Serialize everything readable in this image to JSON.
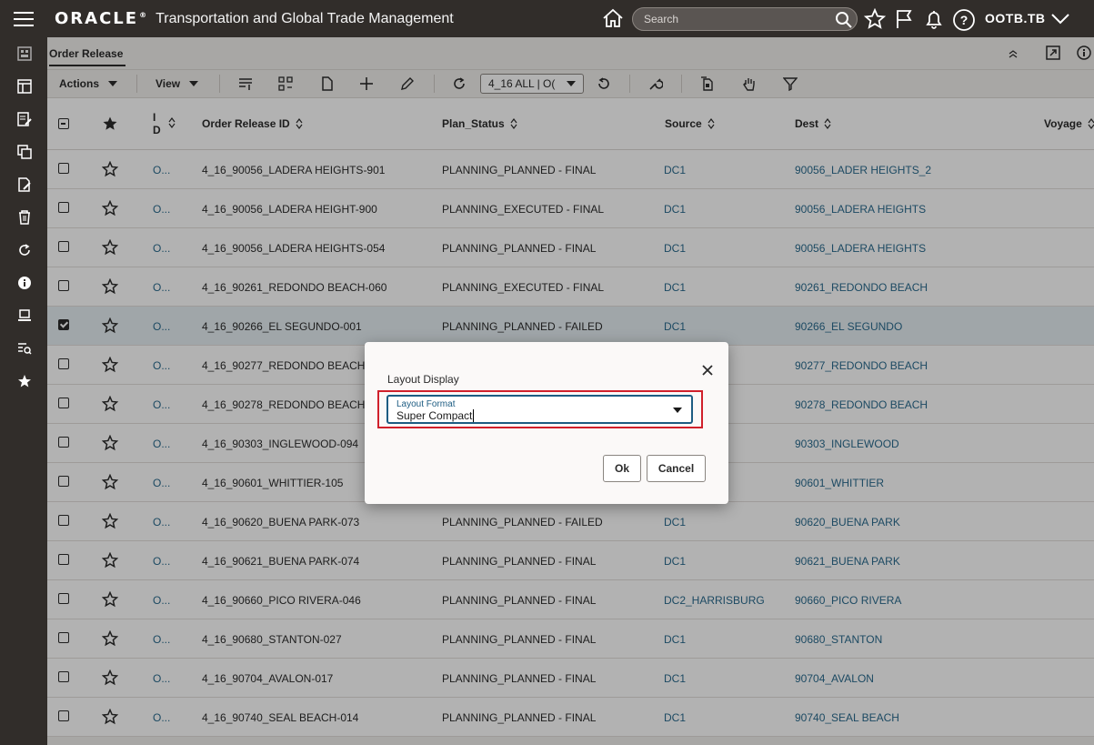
{
  "app": {
    "brand": "ORACLE",
    "title": "Transportation and Global Trade Management",
    "user": "OOTB.TB"
  },
  "search": {
    "placeholder": "Search"
  },
  "panel": {
    "title": "Order Release"
  },
  "toolbar": {
    "actions_label": "Actions",
    "view_label": "View",
    "saved_query": "4_16 ALL | O("
  },
  "table": {
    "headers": {
      "id": "I D",
      "order_release_id": "Order Release ID",
      "plan_status": "Plan_Status",
      "source": "Source",
      "dest": "Dest",
      "voyage": "Voyage"
    },
    "rows": [
      {
        "id": "O...",
        "order_release_id": "4_16_90056_LADERA HEIGHTS-901",
        "plan_status": "PLANNING_PLANNED - FINAL",
        "source": "DC1",
        "dest": "90056_LADER HEIGHTS_2",
        "checked": false
      },
      {
        "id": "O...",
        "order_release_id": "4_16_90056_LADERA HEIGHT-900",
        "plan_status": "PLANNING_EXECUTED - FINAL",
        "source": "DC1",
        "dest": "90056_LADERA HEIGHTS",
        "checked": false
      },
      {
        "id": "O...",
        "order_release_id": "4_16_90056_LADERA HEIGHTS-054",
        "plan_status": "PLANNING_PLANNED - FINAL",
        "source": "DC1",
        "dest": "90056_LADERA HEIGHTS",
        "checked": false
      },
      {
        "id": "O...",
        "order_release_id": "4_16_90261_REDONDO BEACH-060",
        "plan_status": "PLANNING_EXECUTED - FINAL",
        "source": "DC1",
        "dest": "90261_REDONDO BEACH",
        "checked": false
      },
      {
        "id": "O...",
        "order_release_id": "4_16_90266_EL SEGUNDO-001",
        "plan_status": "PLANNING_PLANNED - FAILED",
        "source": "DC1",
        "dest": "90266_EL SEGUNDO",
        "checked": true
      },
      {
        "id": "O...",
        "order_release_id": "4_16_90277_REDONDO BEACH",
        "plan_status": "",
        "source": "",
        "dest": "90277_REDONDO BEACH",
        "checked": false
      },
      {
        "id": "O...",
        "order_release_id": "4_16_90278_REDONDO BEACH",
        "plan_status": "",
        "source": "",
        "dest": "90278_REDONDO BEACH",
        "checked": false
      },
      {
        "id": "O...",
        "order_release_id": "4_16_90303_INGLEWOOD-094",
        "plan_status": "",
        "source": "",
        "dest": "90303_INGLEWOOD",
        "checked": false
      },
      {
        "id": "O...",
        "order_release_id": "4_16_90601_WHITTIER-105",
        "plan_status": "",
        "source": "",
        "dest": "90601_WHITTIER",
        "checked": false
      },
      {
        "id": "O...",
        "order_release_id": "4_16_90620_BUENA PARK-073",
        "plan_status": "PLANNING_PLANNED - FAILED",
        "source": "DC1",
        "dest": "90620_BUENA PARK",
        "checked": false
      },
      {
        "id": "O...",
        "order_release_id": "4_16_90621_BUENA PARK-074",
        "plan_status": "PLANNING_PLANNED - FINAL",
        "source": "DC1",
        "dest": "90621_BUENA PARK",
        "checked": false
      },
      {
        "id": "O...",
        "order_release_id": "4_16_90660_PICO RIVERA-046",
        "plan_status": "PLANNING_PLANNED - FINAL",
        "source": "DC2_HARRISBURG",
        "dest": "90660_PICO RIVERA",
        "checked": false
      },
      {
        "id": "O...",
        "order_release_id": "4_16_90680_STANTON-027",
        "plan_status": "PLANNING_PLANNED - FINAL",
        "source": "DC1",
        "dest": "90680_STANTON",
        "checked": false
      },
      {
        "id": "O...",
        "order_release_id": "4_16_90704_AVALON-017",
        "plan_status": "PLANNING_PLANNED - FINAL",
        "source": "DC1",
        "dest": "90704_AVALON",
        "checked": false
      },
      {
        "id": "O...",
        "order_release_id": "4_16_90740_SEAL BEACH-014",
        "plan_status": "PLANNING_PLANNED - FINAL",
        "source": "DC1",
        "dest": "90740_SEAL BEACH",
        "checked": false
      }
    ]
  },
  "dialog": {
    "title": "Layout Display",
    "field_label": "Layout Format",
    "field_value": "Super Compact",
    "ok_label": "Ok",
    "cancel_label": "Cancel"
  },
  "colors": {
    "header_bg": "#312d2a",
    "link": "#2a6b8e",
    "highlight": "#d0202b",
    "focus": "#1d5c82"
  }
}
